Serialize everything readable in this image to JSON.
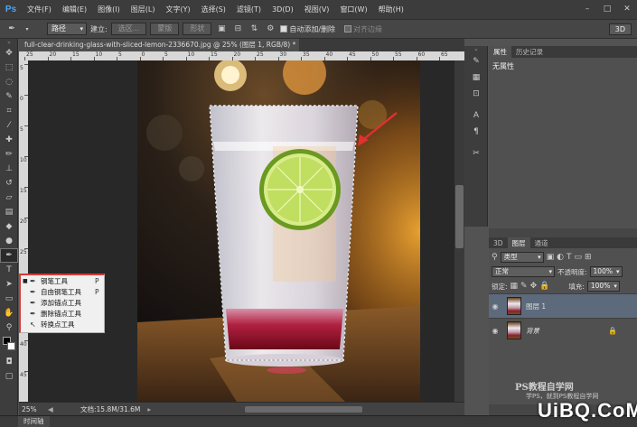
{
  "app": {
    "logo": "Ps",
    "menu": [
      "文件(F)",
      "编辑(E)",
      "图像(I)",
      "图层(L)",
      "文字(Y)",
      "选择(S)",
      "滤镜(T)",
      "3D(D)",
      "视图(V)",
      "窗口(W)",
      "帮助(H)"
    ],
    "window_controls": [
      "–",
      "□",
      "✕"
    ]
  },
  "options_bar": {
    "tool_icon": "pen-icon",
    "mode": "路径",
    "build_label": "建立:",
    "selection_btn": "选区...",
    "mask_btn": "蒙版",
    "shape_btn": "形状",
    "auto_add_delete": {
      "label": "自动添加/删除",
      "checked": true
    },
    "align_edges": {
      "label": "对齐边缘",
      "checked": false
    },
    "btn_3d": "3D"
  },
  "document": {
    "tab_title": "full-clear-drinking-glass-with-sliced-lemon-2336670.jpg @ 25% (图层 1, RGB/8) *",
    "tab_close": "×",
    "ruler_top": [
      "25",
      "20",
      "15",
      "10",
      "5",
      "0",
      "5",
      "10",
      "15",
      "20",
      "25",
      "30",
      "35",
      "40",
      "45",
      "50",
      "55",
      "60",
      "65"
    ],
    "ruler_left": [
      "5",
      "0",
      "5",
      "10",
      "15",
      "20",
      "25",
      "30",
      "35",
      "40",
      "45"
    ]
  },
  "status": {
    "zoom": "25%",
    "doc_info": "文档:15.8M/31.6M"
  },
  "timeline": {
    "tab": "时间轴"
  },
  "flyout": {
    "items": [
      {
        "label": "钢笔工具",
        "key": "P",
        "active": true
      },
      {
        "label": "自由钢笔工具",
        "key": "P",
        "active": false
      },
      {
        "label": "添加锚点工具",
        "key": "",
        "active": false
      },
      {
        "label": "删除锚点工具",
        "key": "",
        "active": false
      },
      {
        "label": "转换点工具",
        "key": "",
        "active": false
      }
    ]
  },
  "properties_panel": {
    "tabs": [
      "属性",
      "历史记录"
    ],
    "body": "无属性"
  },
  "layers_panel": {
    "tabs": [
      "3D",
      "图层",
      "通道"
    ],
    "kind": "类型",
    "blend_mode": "正常",
    "opacity_label": "不透明度:",
    "opacity": "100%",
    "lock_label": "锁定:",
    "fill_label": "填充:",
    "fill": "100%",
    "layers": [
      {
        "name": "图层 1",
        "selected": true,
        "locked": false
      },
      {
        "name": "背景",
        "selected": false,
        "locked": true
      }
    ]
  },
  "watermark": {
    "line1": "PS教程自学网",
    "line2": "学PS，就到PS教程自学网",
    "line3": "UiBQ.CoM"
  },
  "colors": {
    "accent_red": "#d63a3a",
    "ps_blue": "#4ea3f3",
    "selected_layer": "#5d6a7c"
  }
}
